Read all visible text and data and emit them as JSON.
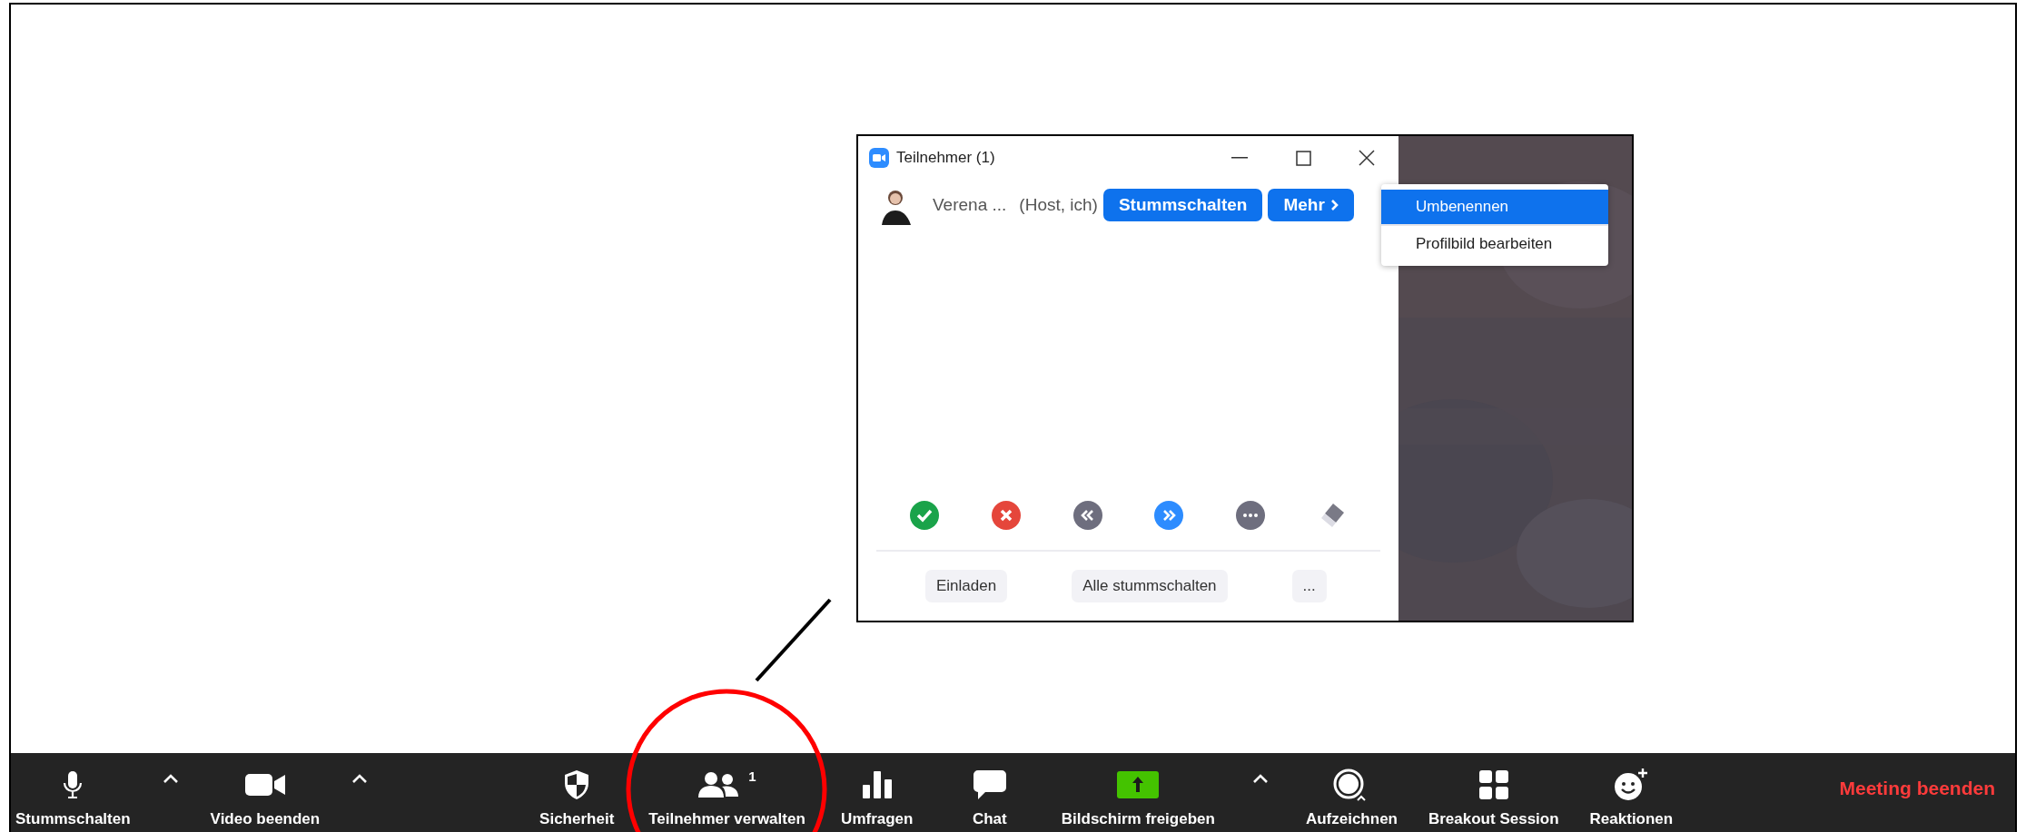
{
  "participants_window": {
    "title": "Teilnehmer (1)",
    "participant": {
      "name": "Verena ...",
      "role": "(Host, ich)",
      "mute_button": "Stummschalten",
      "more_button": "Mehr"
    },
    "more_menu": [
      {
        "label": "Umbenennen",
        "selected": true
      },
      {
        "label": "Profilbild bearbeiten",
        "selected": false
      }
    ],
    "reaction_buttons": [
      {
        "kind": "check",
        "color": "#1aa34a"
      },
      {
        "kind": "cross",
        "color": "#e5463b"
      },
      {
        "kind": "slower",
        "color": "#6e6e7e"
      },
      {
        "kind": "faster",
        "color": "#2d8cff"
      },
      {
        "kind": "more",
        "color": "#6e6e7e"
      },
      {
        "kind": "clear",
        "color": "#7a7a86"
      }
    ],
    "footer_buttons": [
      "Einladen",
      "Alle stummschalten",
      "..."
    ],
    "video_panel": {
      "kind": "picture"
    }
  },
  "toolbar": {
    "left": [
      {
        "kind": "mic",
        "label": "Stummschalten"
      },
      {
        "kind": "caret"
      },
      {
        "kind": "camera",
        "label": "Video beenden"
      },
      {
        "kind": "caret"
      }
    ],
    "center": [
      {
        "kind": "shield",
        "label": "Sicherheit"
      },
      {
        "kind": "people",
        "label": "Teilnehmer verwalten",
        "badge": "1"
      },
      {
        "kind": "poll",
        "label": "Umfragen"
      },
      {
        "kind": "chat",
        "label": "Chat"
      },
      {
        "kind": "share",
        "label": "Bildschirm freigeben"
      },
      {
        "kind": "caret"
      },
      {
        "kind": "record",
        "label": "Aufzeichnen"
      },
      {
        "kind": "breakout",
        "label": "Breakout Session"
      },
      {
        "kind": "reactions",
        "label": "Reaktionen"
      }
    ],
    "end_button": "Meeting beenden"
  }
}
